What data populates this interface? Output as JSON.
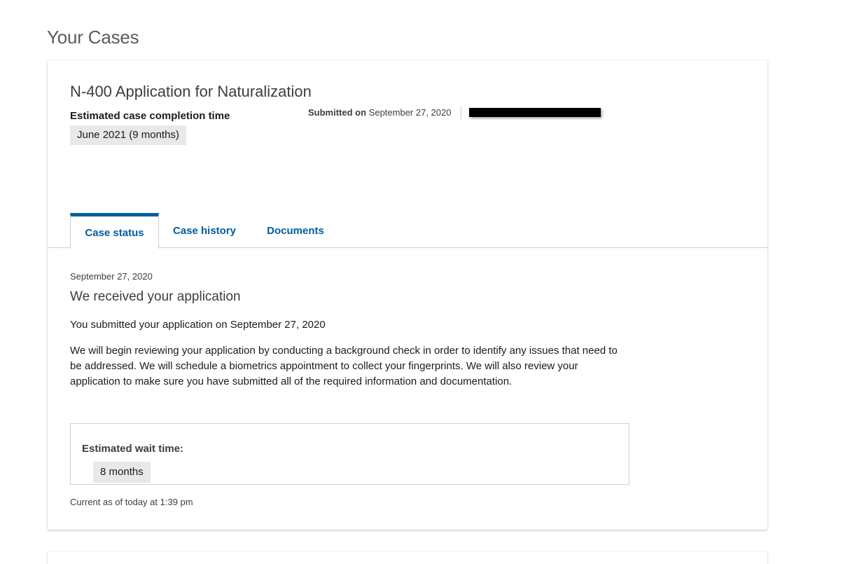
{
  "page": {
    "title": "Your Cases"
  },
  "case": {
    "title": "N-400 Application for Naturalization",
    "estimate_label": "Estimated case completion time",
    "estimate_value": "June 2021 (9 months)",
    "submitted_label": "Submitted on",
    "submitted_date": "September 27, 2020"
  },
  "tabs": [
    {
      "label": "Case status",
      "active": true
    },
    {
      "label": "Case history",
      "active": false
    },
    {
      "label": "Documents",
      "active": false
    }
  ],
  "status": {
    "date": "September 27, 2020",
    "heading": "We received your application",
    "paragraph1": "You submitted your application on September 27, 2020",
    "paragraph2": "We will begin reviewing your application by conducting a background check in order to identify any issues that need to be addressed. We will schedule a biometrics appointment to collect your fingerprints. We will also review your application to make sure you have submitted all of the required information and documentation.",
    "wait_label": "Estimated wait time:",
    "wait_value": "8 months",
    "current_as_of": "Current as of today at 1:39 pm"
  },
  "colors": {
    "accent": "#005ea2",
    "pill_bg": "#e8e8e8",
    "border": "#cfcfcf"
  }
}
